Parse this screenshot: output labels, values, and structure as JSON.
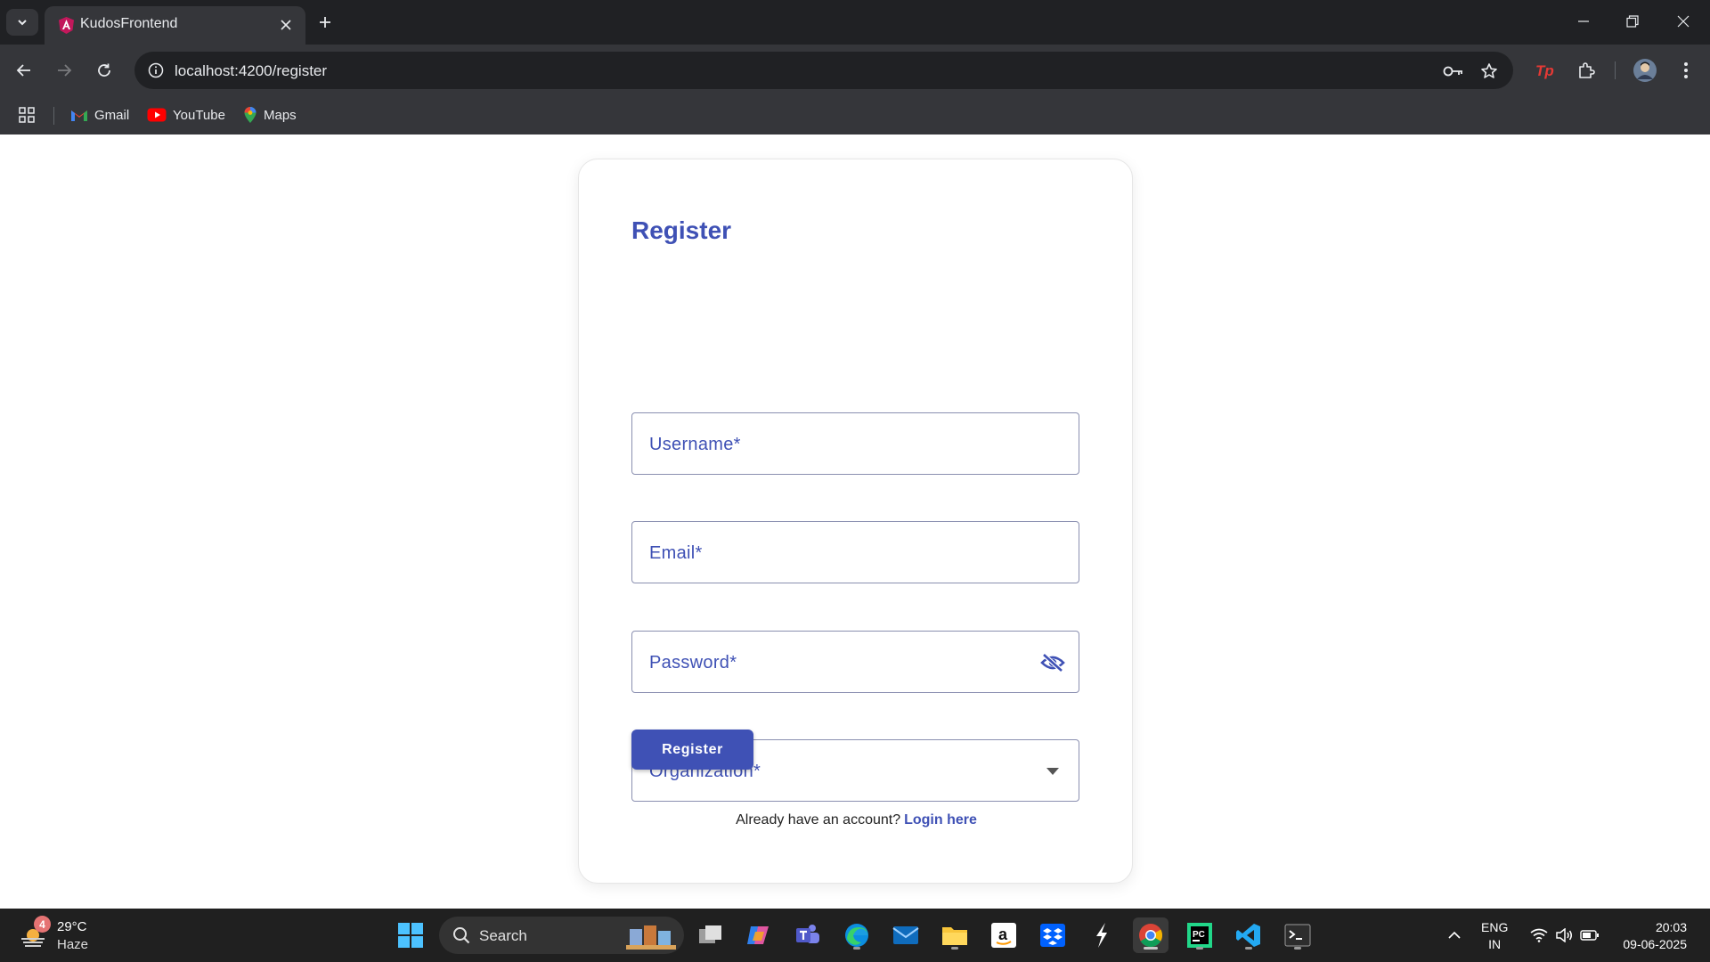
{
  "browser": {
    "tab": {
      "title": "KudosFrontend"
    },
    "address_bar": {
      "url": "localhost:4200/register"
    },
    "bookmarks": [
      {
        "label": "Gmail"
      },
      {
        "label": "YouTube"
      },
      {
        "label": "Maps"
      }
    ]
  },
  "form": {
    "title": "Register",
    "fields": {
      "username": {
        "label": "Username*"
      },
      "email": {
        "label": "Email*"
      },
      "password": {
        "label": "Password*"
      },
      "organization": {
        "label": "Organization*"
      }
    },
    "submit_label": "Register",
    "footer": {
      "text": "Already have an account?",
      "link": "Login here"
    },
    "accent_color": "#3f51b5"
  },
  "taskbar": {
    "weather": {
      "temperature": "29°C",
      "condition": "Haze",
      "badge": "4"
    },
    "search_label": "Search",
    "language": {
      "line1": "ENG",
      "line2": "IN"
    },
    "clock": {
      "time": "20:03",
      "date": "09-06-2025"
    }
  }
}
